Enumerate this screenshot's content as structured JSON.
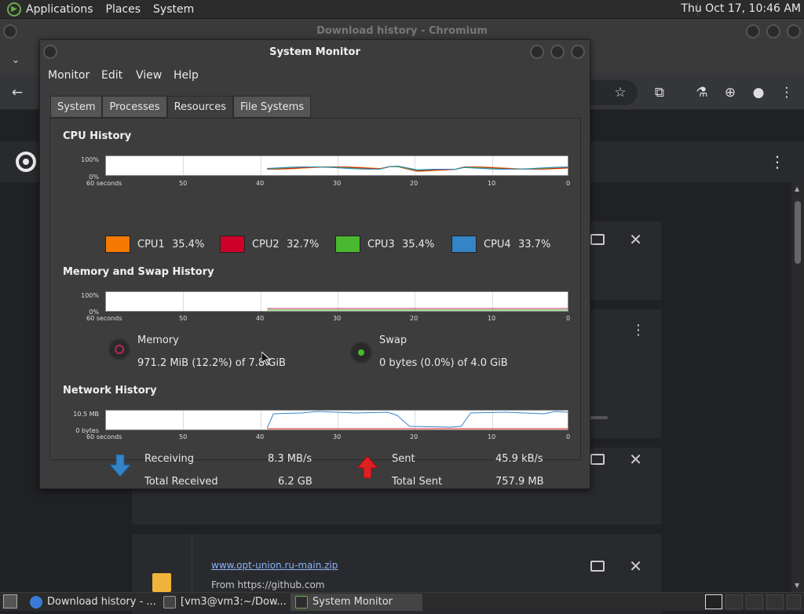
{
  "panel": {
    "menus": [
      "Applications",
      "Places",
      "System"
    ],
    "clock": "Thu Oct 17, 10:46 AM"
  },
  "chromium": {
    "title": "Download history - Chromium",
    "download_file": "www.opt-union.ru-main.zip",
    "download_source": "From https://github.com"
  },
  "sysmon": {
    "title": "System Monitor",
    "menus": [
      "Monitor",
      "Edit",
      "View",
      "Help"
    ],
    "tabs": [
      "System",
      "Processes",
      "Resources",
      "File Systems"
    ],
    "active_tab": "Resources",
    "cpu": {
      "title": "CPU History",
      "y_labels": [
        "100%",
        "0%"
      ],
      "x_labels": [
        "60 seconds",
        "50",
        "40",
        "30",
        "20",
        "10",
        "0"
      ],
      "cores": [
        {
          "name": "CPU1",
          "value": "35.4%",
          "color": "#f57900"
        },
        {
          "name": "CPU2",
          "value": "32.7%",
          "color": "#cc0029"
        },
        {
          "name": "CPU3",
          "value": "35.4%",
          "color": "#4ab830"
        },
        {
          "name": "CPU4",
          "value": "33.7%",
          "color": "#3584c8"
        }
      ]
    },
    "memory": {
      "title": "Memory and Swap History",
      "y_labels": [
        "100%",
        "0%"
      ],
      "x_labels": [
        "60 seconds",
        "50",
        "40",
        "30",
        "20",
        "10",
        "0"
      ],
      "memory_label": "Memory",
      "memory_value": "971.2 MiB (12.2%) of 7.8 GiB",
      "memory_color": "#b8245a",
      "swap_label": "Swap",
      "swap_value": "0 bytes (0.0%) of 4.0 GiB",
      "swap_color": "#4ab830"
    },
    "network": {
      "title": "Network History",
      "y_labels": [
        "10.5 MB",
        "0 bytes"
      ],
      "x_labels": [
        "60 seconds",
        "50",
        "40",
        "30",
        "20",
        "10",
        "0"
      ],
      "receiving_label": "Receiving",
      "receiving_value": "8.3 MB/s",
      "total_received_label": "Total Received",
      "total_received_value": "6.2 GB",
      "sent_label": "Sent",
      "sent_value": "45.9 kB/s",
      "total_sent_label": "Total Sent",
      "total_sent_value": "757.9 MB",
      "receive_color": "#3584c8",
      "sent_color": "#e02020"
    }
  },
  "taskbar": {
    "items": [
      {
        "label": "Download history - ...",
        "icon": "chromium-icon"
      },
      {
        "label": "[vm3@vm3:~/Dow...",
        "icon": "terminal-icon"
      },
      {
        "label": "System Monitor",
        "icon": "system-monitor-icon"
      }
    ]
  }
}
